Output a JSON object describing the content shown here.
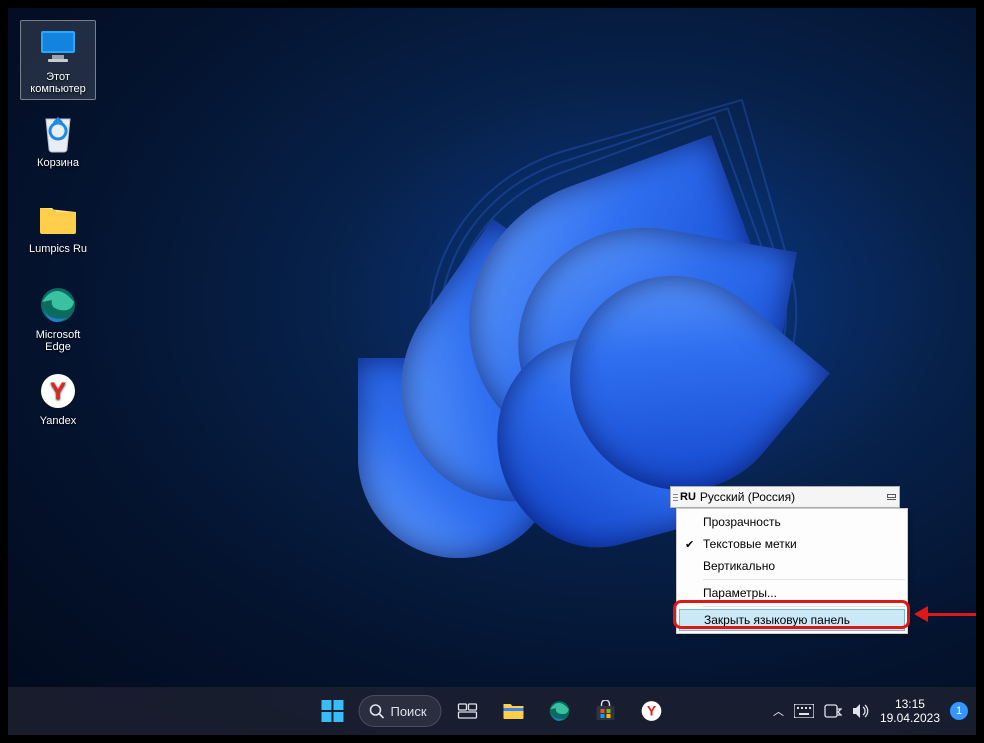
{
  "desktop_icons": [
    {
      "id": "this-pc",
      "label": "Этот\nкомпьютер",
      "selected": true
    },
    {
      "id": "recycle",
      "label": "Корзина",
      "selected": false
    },
    {
      "id": "folder",
      "label": "Lumpics Ru",
      "selected": false
    },
    {
      "id": "edge",
      "label": "Microsoft\nEdge",
      "selected": false
    },
    {
      "id": "yandex",
      "label": "Yandex",
      "selected": false
    }
  ],
  "language_bar": {
    "code": "RU",
    "name": "Русский (Россия)"
  },
  "context_menu": {
    "items": [
      {
        "label": "Прозрачность",
        "checked": false
      },
      {
        "label": "Текстовые метки",
        "checked": true
      },
      {
        "label": "Вертикально",
        "checked": false
      },
      {
        "label": "Параметры...",
        "checked": false,
        "sep_before": true
      },
      {
        "label": "Закрыть языковую панель",
        "checked": false,
        "sep_before": true,
        "highlighted": true
      }
    ]
  },
  "taskbar": {
    "search_label": "Поиск",
    "time": "13:15",
    "date": "19.04.2023",
    "notification_count": "1"
  }
}
